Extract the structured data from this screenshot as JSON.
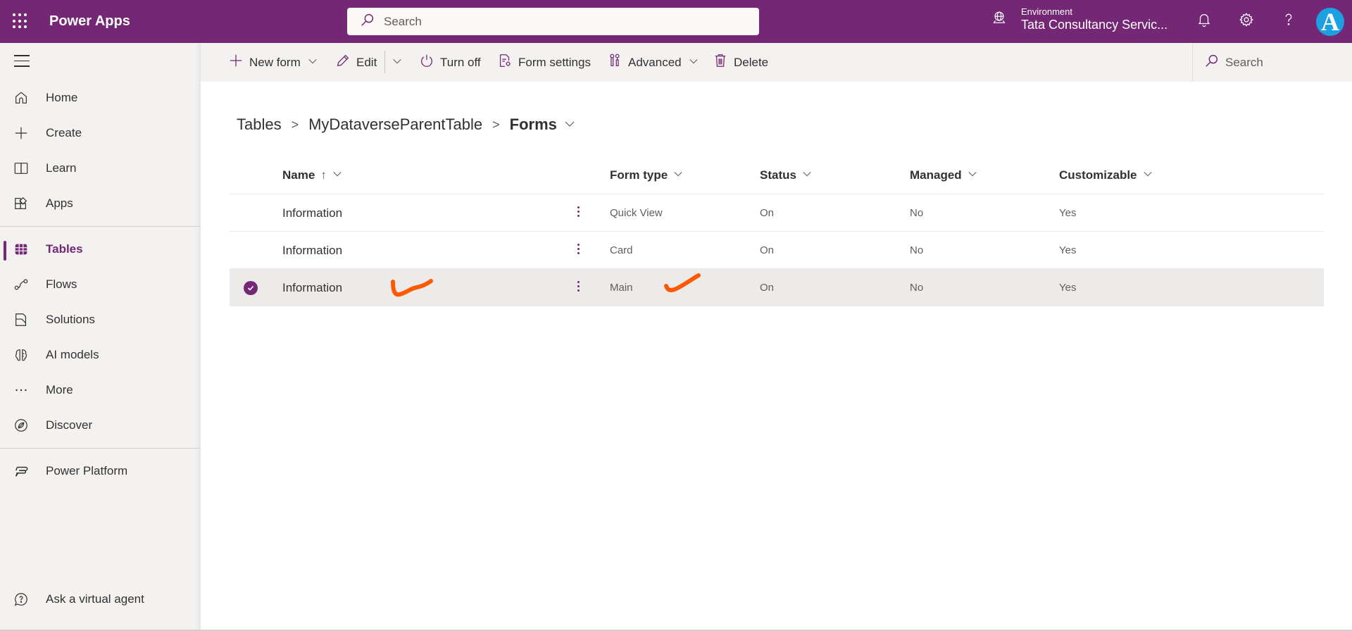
{
  "topbar": {
    "app_title": "Power Apps",
    "search_placeholder": "Search",
    "environment_label": "Environment",
    "environment_name": "Tata Consultancy Servic...",
    "avatar_letter": "A",
    "brand_color": "#742774"
  },
  "sidebar": {
    "items": [
      {
        "label": "Home",
        "icon": "home-icon"
      },
      {
        "label": "Create",
        "icon": "plus-icon"
      },
      {
        "label": "Learn",
        "icon": "book-icon"
      },
      {
        "label": "Apps",
        "icon": "apps-icon"
      },
      {
        "label": "Tables",
        "icon": "table-grid-icon",
        "active": true
      },
      {
        "label": "Flows",
        "icon": "flow-icon"
      },
      {
        "label": "Solutions",
        "icon": "solutions-icon"
      },
      {
        "label": "AI models",
        "icon": "brain-icon"
      },
      {
        "label": "More",
        "icon": "more-horizontal-icon"
      },
      {
        "label": "Discover",
        "icon": "compass-icon"
      },
      {
        "label": "Power Platform",
        "icon": "power-platform-icon"
      }
    ],
    "footer_item": {
      "label": "Ask a virtual agent",
      "icon": "chat-help-icon"
    }
  },
  "commandbar": {
    "new_form": "New form",
    "edit": "Edit",
    "turn_off": "Turn off",
    "form_settings": "Form settings",
    "advanced": "Advanced",
    "delete": "Delete",
    "search_placeholder": "Search"
  },
  "breadcrumb": {
    "items": [
      "Tables",
      "MyDataverseParentTable",
      "Forms"
    ]
  },
  "table": {
    "columns": [
      {
        "label": "Name",
        "sorted": "ascending"
      },
      {
        "label": "Form type"
      },
      {
        "label": "Status"
      },
      {
        "label": "Managed"
      },
      {
        "label": "Customizable"
      }
    ],
    "rows": [
      {
        "name": "Information",
        "form_type": "Quick View",
        "status": "On",
        "managed": "No",
        "customizable": "Yes",
        "selected": false
      },
      {
        "name": "Information",
        "form_type": "Card",
        "status": "On",
        "managed": "No",
        "customizable": "Yes",
        "selected": false
      },
      {
        "name": "Information",
        "form_type": "Main",
        "status": "On",
        "managed": "No",
        "customizable": "Yes",
        "selected": true
      }
    ]
  },
  "annotations": {
    "color": "#ff5a00"
  }
}
